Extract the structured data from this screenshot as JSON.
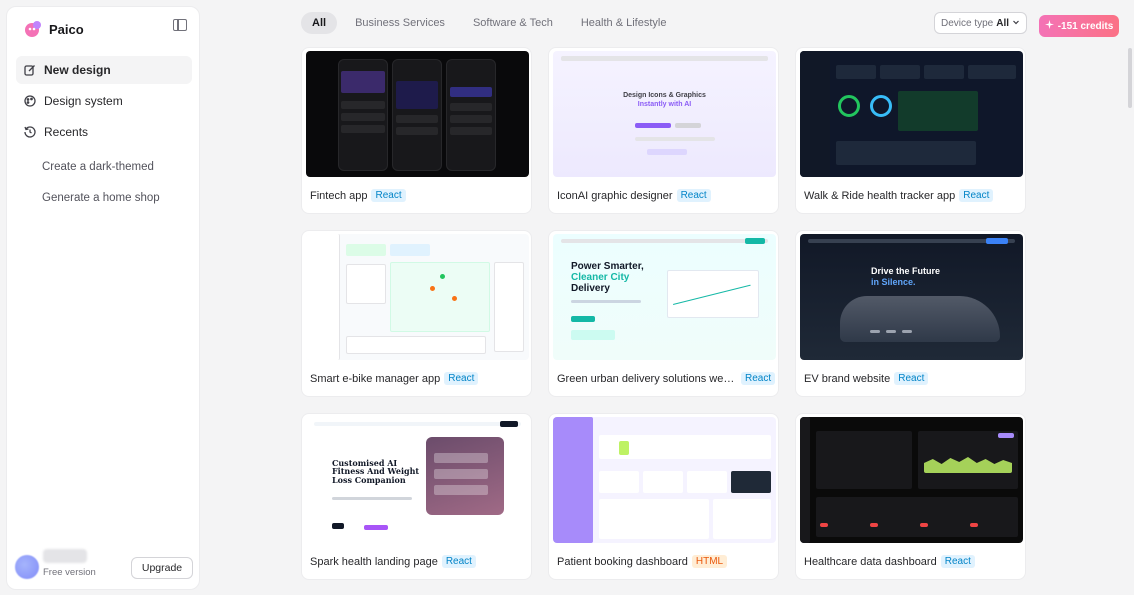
{
  "brand": {
    "name": "Paico"
  },
  "nav": {
    "new_design": "New design",
    "design_system": "Design system",
    "recents": "Recents"
  },
  "recents": [
    "Create a dark-themed",
    "Generate a home shop"
  ],
  "account": {
    "plan": "Free version",
    "upgrade_label": "Upgrade"
  },
  "tabs": [
    {
      "label": "All",
      "active": true
    },
    {
      "label": "Business Services",
      "active": false
    },
    {
      "label": "Software & Tech",
      "active": false
    },
    {
      "label": "Health & Lifestyle",
      "active": false
    }
  ],
  "device_type": {
    "label": "Device type",
    "value": "All"
  },
  "credits": {
    "label": "-151 credits"
  },
  "cards": [
    {
      "title": "Fintech app",
      "tech": "React"
    },
    {
      "title": "IconAI graphic designer",
      "tech": "React"
    },
    {
      "title": "Walk & Ride health tracker app",
      "tech": "React"
    },
    {
      "title": "Smart e-bike manager app",
      "tech": "React"
    },
    {
      "title": "Green urban delivery solutions web...",
      "tech": "React"
    },
    {
      "title": "EV brand website",
      "tech": "React"
    },
    {
      "title": "Spark health landing page",
      "tech": "React"
    },
    {
      "title": "Patient booking dashboard",
      "tech": "HTML"
    },
    {
      "title": "Healthcare data dashboard",
      "tech": "React"
    }
  ],
  "thumbs": {
    "iconai_heading": "Design Icons & Graphics",
    "iconai_sub": "Instantly with AI",
    "delivery_h1": "Power Smarter,",
    "delivery_h2": "Cleaner City",
    "delivery_h3": "Delivery",
    "ev_h1": "Drive the Future",
    "ev_h2": "in Silence.",
    "spark_heading": "Customised AI Fitness And Weight Loss Companion"
  },
  "colors": {
    "accent_pink": "#fb7185",
    "react_badge": "#0284c7",
    "html_badge": "#ea580c"
  }
}
